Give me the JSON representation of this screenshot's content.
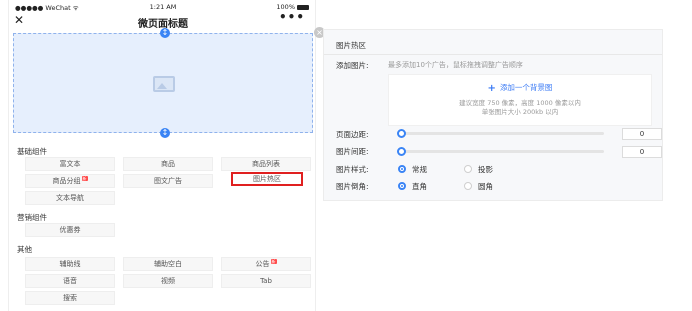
{
  "status_bar": {
    "carrier": "●●●●● WeChat ᯤ",
    "time": "1:21 AM",
    "battery": "100%"
  },
  "navbar": {
    "close_icon": "close-icon",
    "title": "微页面标题",
    "more": "•••"
  },
  "hotzone": {
    "handle_top": "↕",
    "handle_bottom": "↕",
    "delete": "×"
  },
  "components": {
    "basic_title": "基础组件",
    "basic": [
      "富文本",
      "商品",
      "商品列表",
      "商品分组",
      "图文广告",
      "图片热区",
      "文本导航"
    ],
    "marketing_title": "营销组件",
    "marketing": [
      "优惠券"
    ],
    "other_title": "其他",
    "other": [
      "辅助线",
      "辅助空白",
      "公告",
      "语音",
      "视频",
      "Tab",
      "搜索"
    ],
    "badge_text": "新"
  },
  "panel": {
    "title": "图片热区",
    "add_label": "添加图片:",
    "add_hint": "最多添加10个广告，鼠标拖拽调整广告顺序",
    "upload_button": "添加一个背景图",
    "upload_note1": "建议宽度 750 像素，高度 1000 像素以内",
    "upload_note2": "单张图片大小 200kb 以内",
    "margin_label": "页面边距:",
    "margin_value": "0",
    "spacing_label": "图片间距:",
    "spacing_value": "0",
    "style_label": "图片样式:",
    "style_options": [
      "常规",
      "投影"
    ],
    "corner_label": "图片倒角:",
    "corner_options": [
      "直角",
      "圆角"
    ]
  },
  "colors": {
    "accent": "#3a84f5",
    "selected_border": "#e02020",
    "hotzone_bg": "#e6effd"
  }
}
